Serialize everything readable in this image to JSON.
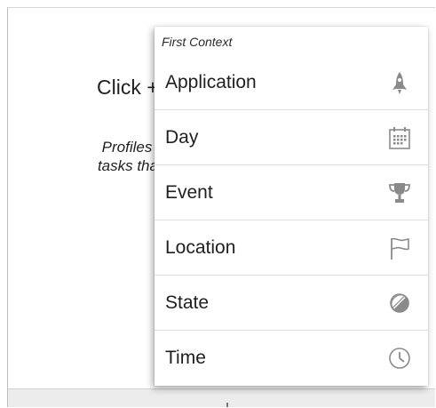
{
  "background": {
    "heading": "Click +",
    "body_lines": [
      "Profiles link cc",
      "tasks that shoul"
    ]
  },
  "menu": {
    "title": "First Context",
    "items": [
      {
        "label": "Application",
        "icon": "rocket-icon"
      },
      {
        "label": "Day",
        "icon": "calendar-icon"
      },
      {
        "label": "Event",
        "icon": "trophy-icon"
      },
      {
        "label": "Location",
        "icon": "flag-icon"
      },
      {
        "label": "State",
        "icon": "half-circle-icon"
      },
      {
        "label": "Time",
        "icon": "clock-icon"
      }
    ]
  },
  "colors": {
    "icon_gray": "#8a8a8a",
    "divider": "#dedede",
    "bottom_bar": "#ececec"
  }
}
